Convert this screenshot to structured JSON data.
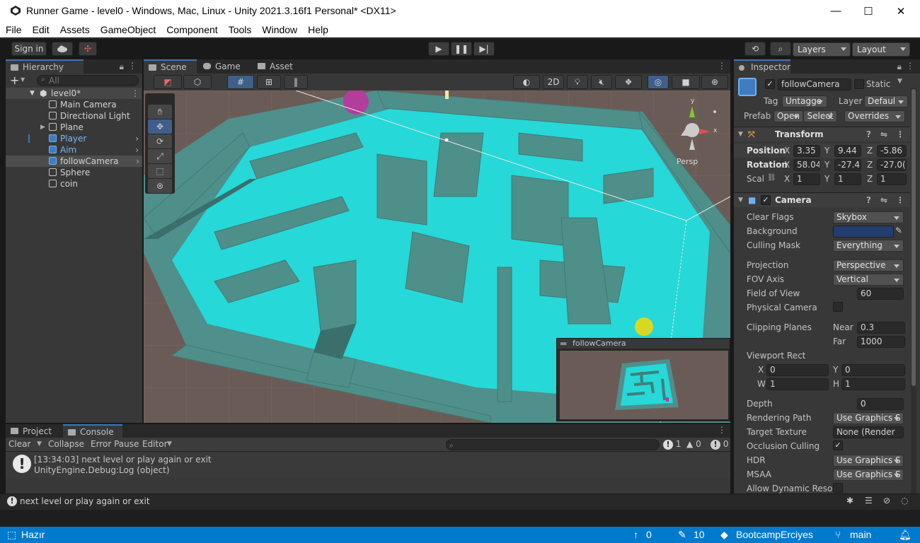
{
  "window": {
    "title": "Runner Game - level0 - Windows, Mac, Linux - Unity 2021.3.16f1 Personal* <DX11>",
    "minimize": "—",
    "maximize": "☐",
    "close": "✕"
  },
  "menu": [
    "File",
    "Edit",
    "Assets",
    "GameObject",
    "Component",
    "Tools",
    "Window",
    "Help"
  ],
  "toolbar": {
    "signin": "Sign in",
    "layers": "Layers",
    "layout": "Layout"
  },
  "hierarchy": {
    "tab": "Hierarchy",
    "search_placeholder": "All",
    "scene": "level0*",
    "items": [
      "Main Camera",
      "Directional Light",
      "Plane",
      "Player",
      "Aim",
      "followCamera",
      "Sphere",
      "coin"
    ]
  },
  "scene": {
    "tabs": [
      "Scene",
      "Game",
      "Asset Store"
    ],
    "mode_2d": "2D",
    "persp": "Persp",
    "preview_title": "followCamera"
  },
  "inspector": {
    "tab": "Inspector",
    "object_name": "followCamera",
    "static": "Static",
    "tag_label": "Tag",
    "tag_value": "Untagge",
    "layer_label": "Layer",
    "layer_value": "Defaul",
    "prefab_label": "Prefab",
    "prefab_open": "Open",
    "prefab_select": "Select",
    "prefab_overrides": "Overrides",
    "transform": {
      "title": "Transform",
      "position_label": "Position",
      "rotation_label": "Rotation",
      "scale_label": "Scal",
      "axis_x": "X",
      "axis_y": "Y",
      "axis_z": "Z",
      "position": [
        "3.35",
        "9.44",
        "-5.86"
      ],
      "rotation": [
        "58.04",
        "-27.4:",
        "-27.0("
      ],
      "scale": [
        "1",
        "1",
        "1"
      ]
    },
    "camera": {
      "title": "Camera",
      "rows": [
        {
          "label": "Clear Flags",
          "value": "Skybox"
        },
        {
          "label": "Background",
          "value": ""
        },
        {
          "label": "Culling Mask",
          "value": "Everything"
        },
        {
          "label": "Projection",
          "value": "Perspective"
        },
        {
          "label": "FOV Axis",
          "value": "Vertical"
        },
        {
          "label": "Field of View",
          "value": "60"
        },
        {
          "label": "Physical Camera",
          "value": ""
        },
        {
          "label": "Clipping Planes",
          "value": ""
        },
        {
          "label": "Viewport Rect",
          "value": ""
        },
        {
          "label": "Depth",
          "value": "0"
        },
        {
          "label": "Rendering Path",
          "value": "Use Graphics S"
        },
        {
          "label": "Target Texture",
          "value": "None (Render"
        },
        {
          "label": "Occlusion Culling",
          "value": ""
        },
        {
          "label": "HDR",
          "value": "Use Graphics S"
        },
        {
          "label": "MSAA",
          "value": "Use Graphics S"
        },
        {
          "label": "Allow Dynamic Resol",
          "value": ""
        }
      ],
      "near_label": "Near",
      "near": "0.3",
      "far_label": "Far",
      "far": "1000",
      "vp_x": "0",
      "vp_y": "0",
      "vp_w": "1",
      "vp_h": "1",
      "vp_x_label": "X",
      "vp_y_label": "Y",
      "vp_w_label": "W",
      "vp_h_label": "H",
      "background_color": "#223d6e"
    }
  },
  "console": {
    "tabs": [
      "Project",
      "Console"
    ],
    "clear": "Clear",
    "collapse": "Collapse",
    "error_pause": "Error Pause",
    "editor": "Editor",
    "count_log": "1",
    "count_warn": "0",
    "count_err": "0",
    "entry_line1": "[13:34:03] next level or play again or exit",
    "entry_line2": "UnityEngine.Debug:Log (object)"
  },
  "editor_status": "next level or play again or exit",
  "statusbar": {
    "ready": "Hazır",
    "up_count": "0",
    "edits": "10",
    "repo": "BootcampErciyes",
    "branch": "main"
  }
}
